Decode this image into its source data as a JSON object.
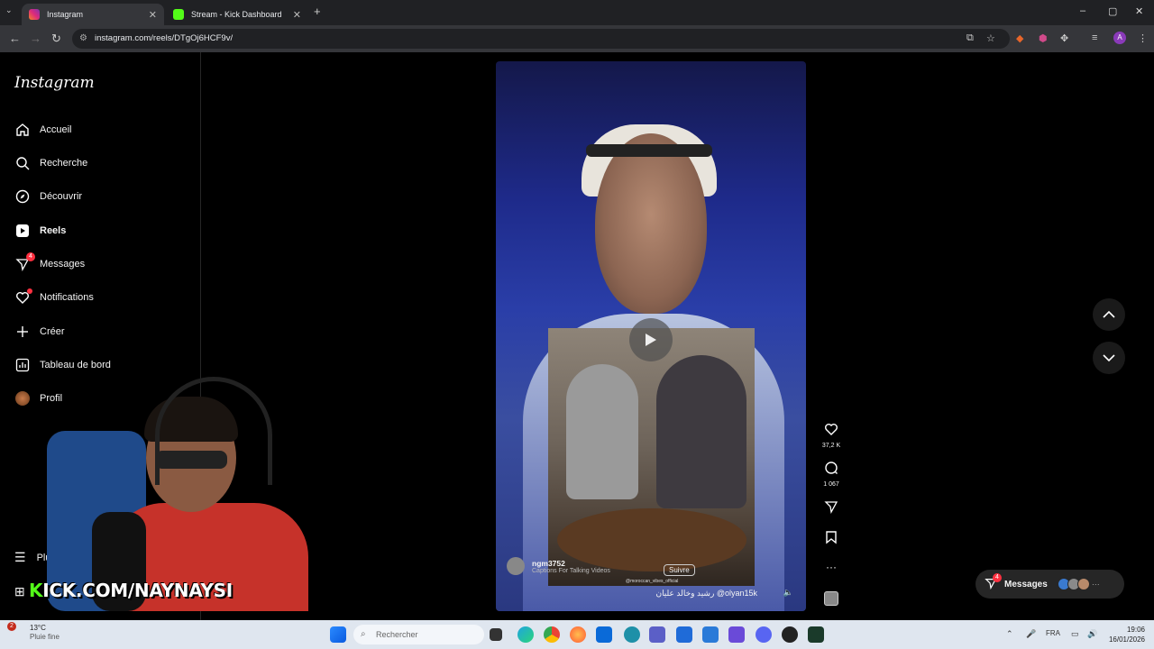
{
  "browser": {
    "tabs": [
      {
        "title": "Instagram",
        "active": true
      },
      {
        "title": "Stream - Kick Dashboard",
        "active": false
      }
    ],
    "url": "instagram.com/reels/DTgOj6HCF9v/"
  },
  "sidebar": {
    "logo": "Instagram",
    "items": [
      {
        "label": "Accueil",
        "icon": "home-icon"
      },
      {
        "label": "Recherche",
        "icon": "search-icon"
      },
      {
        "label": "Découvrir",
        "icon": "compass-icon"
      },
      {
        "label": "Reels",
        "icon": "reels-icon"
      },
      {
        "label": "Messages",
        "icon": "messenger-icon",
        "badge": "4"
      },
      {
        "label": "Notifications",
        "icon": "heart-icon"
      },
      {
        "label": "Créer",
        "icon": "plus-icon"
      },
      {
        "label": "Tableau de bord",
        "icon": "dashboard-icon"
      },
      {
        "label": "Profil",
        "icon": "avatar"
      }
    ],
    "more_label": "Plu"
  },
  "reel": {
    "author": "ngm3752",
    "author_sub": "Captions For Talking Videos",
    "follow_label": "Suivre",
    "caption": "رشيد وخالد عليان @olyan15k",
    "watermark": "@moroccan_vibes_official"
  },
  "actions": {
    "likes": "37,2 K",
    "comments": "1 067"
  },
  "messages_float": {
    "label": "Messages",
    "badge": "4"
  },
  "overlay": {
    "kick_url": "KICK.COM/NAYNAYSI"
  },
  "taskbar": {
    "weather_temp": "13°C",
    "weather_desc": "Pluie fine",
    "weather_badge": "2",
    "search_placeholder": "Rechercher",
    "lang": "FRA",
    "time": "19:06",
    "date": "16/01/2026"
  },
  "colors": {
    "accent_red": "#ff3040",
    "kick_green": "#53fc18"
  }
}
